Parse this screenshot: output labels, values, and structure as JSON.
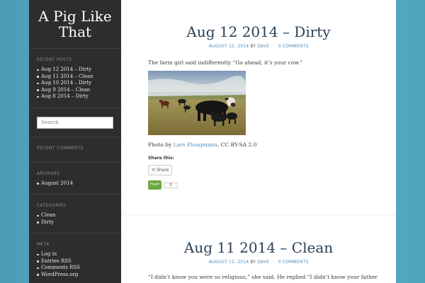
{
  "site": {
    "title_line1": "A Pig Like",
    "title_line2": "That"
  },
  "sidebar": {
    "recent_posts": {
      "title": "RECENT POSTS",
      "items": [
        "Aug 12 2014 – Dirty",
        "Aug 11 2014 – Clean",
        "Aug 10 2014 – Dirty",
        "Aug 9 2014 – Clean",
        "Aug 8 2014 – Dirty"
      ]
    },
    "search": {
      "placeholder": "Search"
    },
    "recent_comments": {
      "title": "RECENT COMMENTS"
    },
    "archives": {
      "title": "ARCHIVES",
      "items": [
        "August 2014"
      ]
    },
    "categories": {
      "title": "CATEGORIES",
      "items": [
        "Clean",
        "Dirty"
      ]
    },
    "meta": {
      "title": "META",
      "items": [
        "Log in",
        "Entries RSS",
        "Comments RSS",
        "WordPress.org"
      ]
    }
  },
  "posts": [
    {
      "title": "Aug 12 2014 – Dirty",
      "date": "AUGUST 12, 2014",
      "by": "BY",
      "author": "DAVE",
      "comments": "0 COMMENTS",
      "text": "The farm girl said indifferently “Go ahead, it’s your cow.”",
      "credit_prefix": "Photo by ",
      "credit_link": "Lars Plougmann",
      "credit_suffix": ", CC BY-SA 2.0",
      "share_title": "Share this:",
      "share_label": "Share",
      "flattr_label": "Flattr",
      "flattr_count": "0"
    },
    {
      "title": "Aug 11 2014 – Clean",
      "date": "AUGUST 11, 2014",
      "by": "BY",
      "author": "DAVE",
      "comments": "0 COMMENTS",
      "text": "“I didn’t know you were so religious,” she said. He replied “I didn’t know your father"
    }
  ],
  "colors": {
    "sidebar_bg": "#2d2d2d",
    "link": "#4a8cc0",
    "title": "#2a4157",
    "flattr": "#6aa83b"
  }
}
